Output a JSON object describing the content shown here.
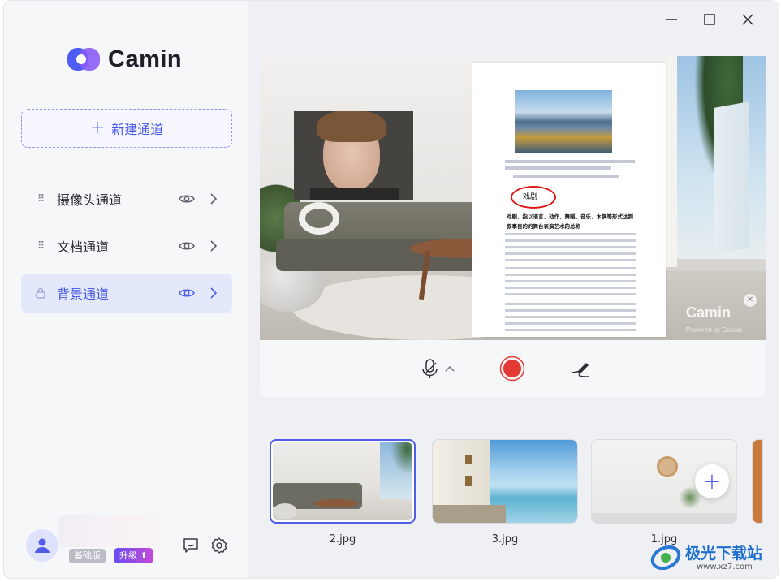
{
  "app": {
    "name": "Camin"
  },
  "sidebar": {
    "new_channel_label": "新建通道",
    "channels": [
      {
        "label": "摄像头通道",
        "active": false
      },
      {
        "label": "文档通道",
        "active": false
      },
      {
        "label": "背景通道",
        "active": true
      }
    ],
    "user": {
      "tier_label": "基础版",
      "upgrade_label": "升级"
    }
  },
  "preview": {
    "document": {
      "heading": "戏剧",
      "subtitle": "戏剧，指以语言、动作、舞蹈、音乐、木偶等形式达到叙事目的的舞台表演艺术的总称"
    },
    "watermark": {
      "brand": "Camin",
      "powered": "Powered by Cassin"
    }
  },
  "thumbnails": [
    {
      "label": "2.jpg",
      "selected": true
    },
    {
      "label": "3.jpg",
      "selected": false
    },
    {
      "label": "1.jpg",
      "selected": false
    }
  ],
  "site_watermark": {
    "text": "极光下载站",
    "url": "www.xz7.com"
  },
  "colors": {
    "accent": "#4f5ee8",
    "record": "#e53935"
  }
}
